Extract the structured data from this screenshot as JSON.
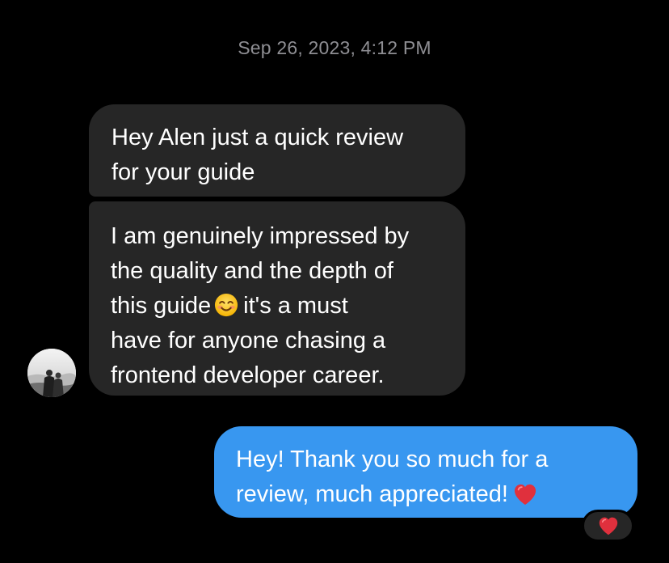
{
  "thread": {
    "timestamp": "Sep 26, 2023, 4:12 PM"
  },
  "messages": {
    "incoming_1": {
      "lines": [
        "Hey Alen just a quick review",
        "for your guide"
      ]
    },
    "incoming_2": {
      "line_1": "I am genuinely impressed by",
      "line_2": "the quality and the depth of",
      "line_3_before_emoji": "this guide",
      "line_3_after_emoji": "it's a must",
      "line_4": "have for anyone chasing a",
      "line_5": "frontend developer career.",
      "emoji": "smiling-face-icon"
    },
    "outgoing_1": {
      "line_1": "Hey! Thank you so much for a",
      "line_2": "review, much appreciated!",
      "emoji": "red-heart-icon"
    }
  },
  "reaction": {
    "emoji": "red-heart-icon"
  },
  "colors": {
    "background": "#000000",
    "incoming_bubble": "#262626",
    "outgoing_bubble": "#3897f0",
    "timestamp": "#8e8e93",
    "heart": "#e0303d"
  }
}
